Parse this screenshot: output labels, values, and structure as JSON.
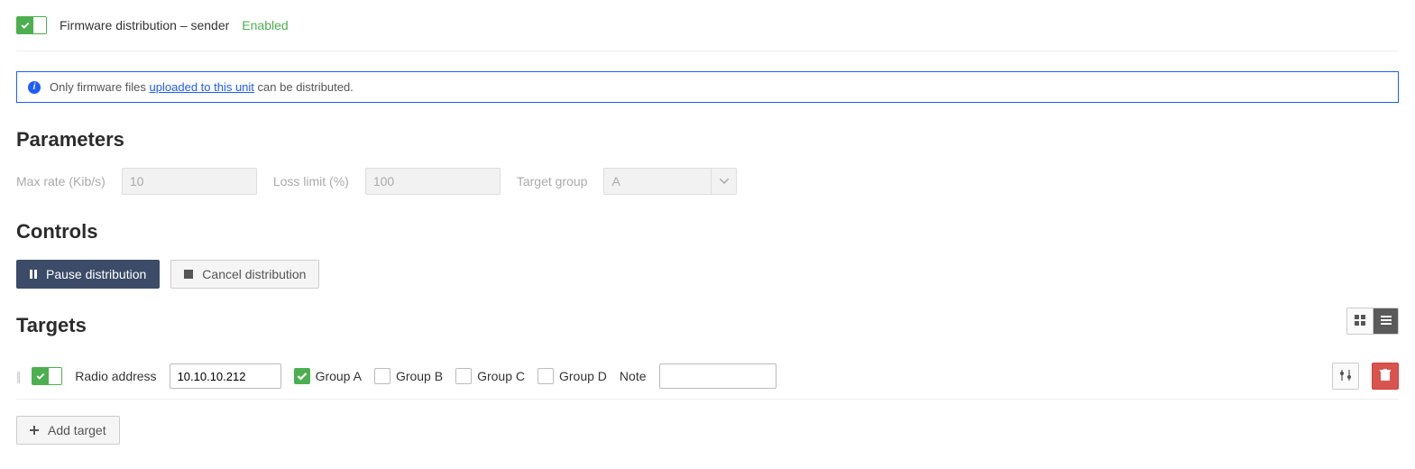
{
  "header": {
    "title": "Firmware distribution – sender",
    "status": "Enabled"
  },
  "info": {
    "prefix": "Only firmware files",
    "link": "uploaded to this unit",
    "suffix": "can be distributed."
  },
  "sections": {
    "parameters": "Parameters",
    "controls": "Controls",
    "targets": "Targets"
  },
  "params": {
    "max_rate_label": "Max rate (Kib/s)",
    "max_rate_value": "10",
    "loss_limit_label": "Loss limit (%)",
    "loss_limit_value": "100",
    "target_group_label": "Target group",
    "target_group_value": "A"
  },
  "controls": {
    "pause": "Pause distribution",
    "cancel": "Cancel distribution"
  },
  "targets": {
    "row": {
      "radio_label": "Radio address",
      "radio_value": "10.10.10.212",
      "group_a": "Group A",
      "group_b": "Group B",
      "group_c": "Group C",
      "group_d": "Group D",
      "note_label": "Note",
      "note_value": ""
    },
    "add_label": "Add target"
  }
}
